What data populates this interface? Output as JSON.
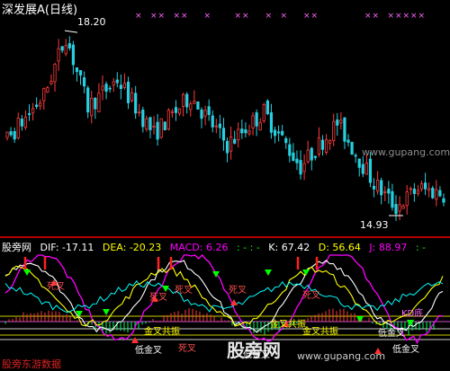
{
  "title": "深发展A(日线)",
  "price_high_label": "18.20",
  "price_low_label": "14.93",
  "indicator_row": {
    "brand": "股旁网",
    "dif": "DIF: -17.11",
    "dea": "DEA: -20.23",
    "macd": "MACD: 6.26",
    "dots": ": - : -",
    "k": "K: 67.42",
    "d": "D: 56.64",
    "j": "J: 88.97",
    "tail": ": -"
  },
  "signal_labels": [
    "死叉",
    "死叉",
    "死叉",
    "死叉",
    "死叉",
    "金叉共振",
    "金叉共振",
    "金叉共振",
    "低金叉",
    "低金叉",
    "低金叉",
    "低金叉",
    "死叉",
    "KD底"
  ],
  "watermarks": {
    "bottom_left": "股旁东游数据",
    "center": "股旁网",
    "url": "www.gupang.com",
    "mid_right": "www.gupang.com"
  },
  "colors": {
    "up": "#ff3b3b",
    "down": "#27d0e0",
    "dif": "#ffffff",
    "dea": "#ffff00",
    "macd": "#ff00ff",
    "k": "#ffffff",
    "d": "#ffff00",
    "j": "#ff00ff",
    "marker": "#ff66ff"
  },
  "chart_data": [
    {
      "type": "candlestick",
      "title": "深发展A(日线)",
      "ylim": [
        14.5,
        18.4
      ],
      "annotations": [
        {
          "text": "18.20",
          "value": 18.2
        },
        {
          "text": "14.93",
          "value": 14.93
        }
      ],
      "seed": 7,
      "count": 120
    },
    {
      "type": "line",
      "series": [
        {
          "name": "DIF",
          "last": -17.11
        },
        {
          "name": "DEA",
          "last": -20.23
        },
        {
          "name": "MACD",
          "last": 6.26
        },
        {
          "name": "K",
          "last": 67.42
        },
        {
          "name": "D",
          "last": 56.64
        },
        {
          "name": "J",
          "last": 88.97
        }
      ]
    }
  ]
}
